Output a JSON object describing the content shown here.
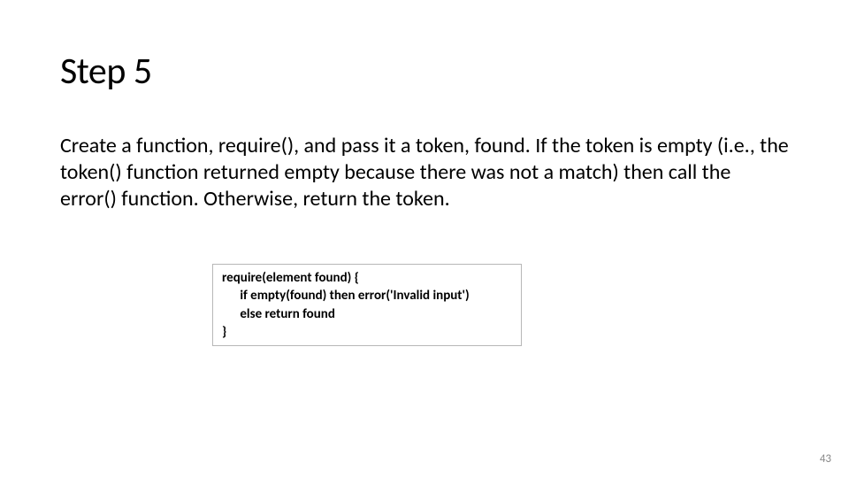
{
  "title": "Step 5",
  "body": "Create a function, require(), and pass it a token, found. If the token is empty (i.e., the token() function returned empty because there was not a match) then call the error() function. Otherwise, return the token.",
  "code": "require(element found) {\n      if empty(found) then error('Invalid input')\n      else return found\n}",
  "page_number": "43"
}
